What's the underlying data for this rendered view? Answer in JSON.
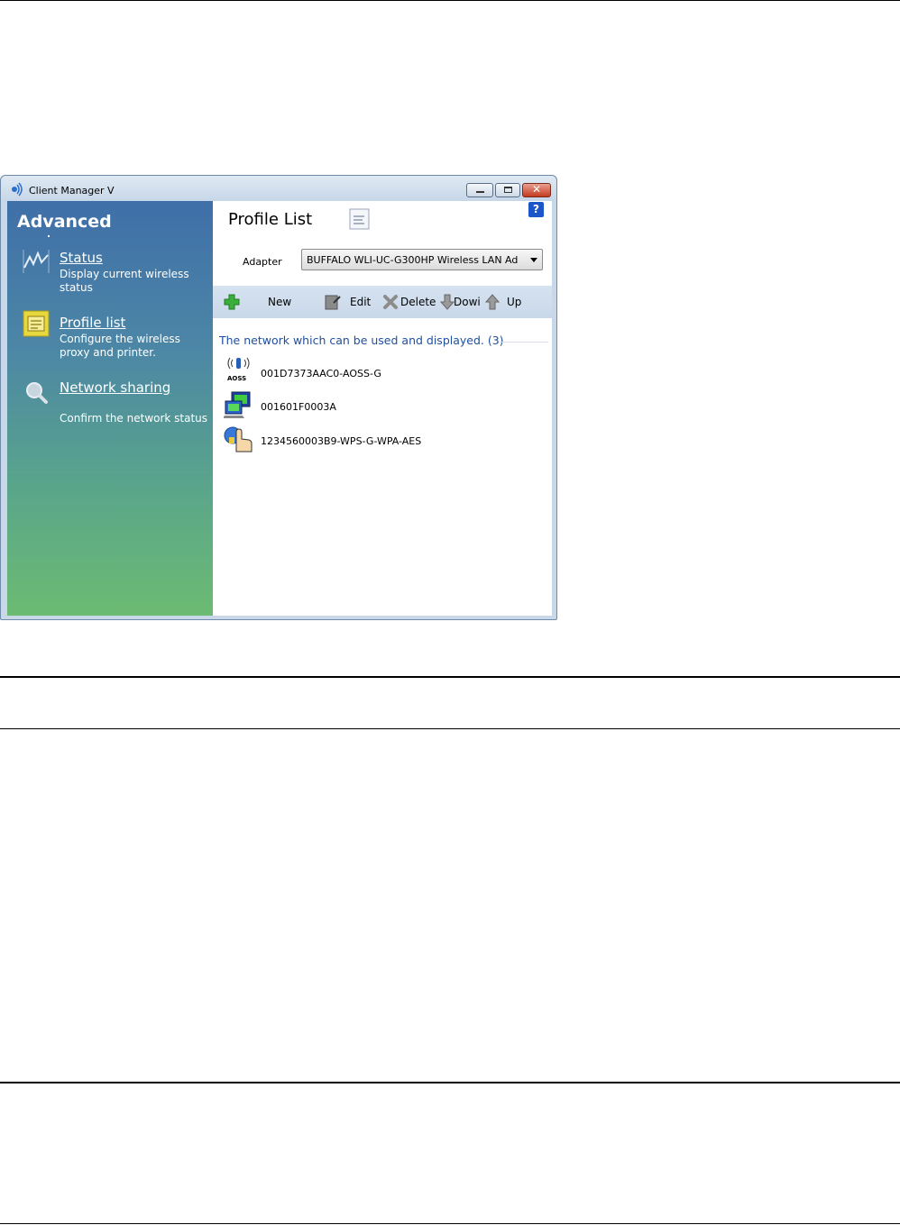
{
  "window": {
    "title": "Client Manager V"
  },
  "sidebar": {
    "title": "Advanced",
    "items": [
      {
        "label": "Status",
        "description": "Display current wireless status",
        "icon": "status-wave-icon"
      },
      {
        "label": "Profile list",
        "description": "Configure the wireless proxy and printer.",
        "icon": "profile-list-icon"
      },
      {
        "label": "Network sharing",
        "description": "Confirm the network status",
        "icon": "magnifier-icon"
      }
    ]
  },
  "main": {
    "title": "Profile List",
    "help_label": "?",
    "adapter_label": "Adapter",
    "adapter_value": "BUFFALO WLI-UC-G300HP  Wireless LAN Ad",
    "toolbar": {
      "new_label": "New",
      "edit_label": "Edit",
      "delete_label": "Delete",
      "down_label": "Dowi",
      "up_label": "Up"
    },
    "section_label": "The network which can be used and displayed. (3)",
    "profiles": [
      {
        "name": "001D7373AAC0-AOSS-G",
        "icon": "aoss-icon",
        "icon_caption": "AOSS"
      },
      {
        "name": "001601F0003A",
        "icon": "network-computer-icon"
      },
      {
        "name": "1234560003B9-WPS-G-WPA-AES",
        "icon": "wps-hand-icon"
      }
    ]
  },
  "colors": {
    "sidebar_top": "#3f6fa8",
    "sidebar_bottom": "#6cbb72",
    "section_text": "#1f4fa0",
    "toolbar_bg": "#d6e2f0"
  }
}
